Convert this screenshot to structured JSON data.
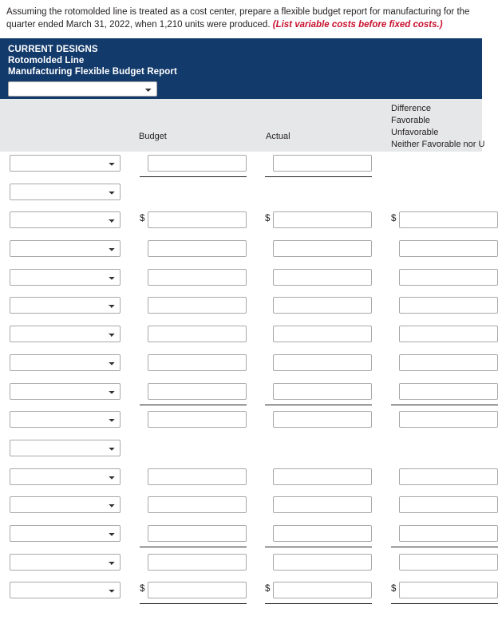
{
  "prompt": {
    "text_part1": "Assuming the rotomolded line is treated as a cost center, prepare a flexible budget report for manufacturing for the quarter ended March 31, 2022, when 1,210 units were produced. ",
    "hint": "(List variable costs before fixed costs.)"
  },
  "report_header": {
    "company": "CURRENT DESIGNS",
    "line": "Rotomolded Line",
    "title": "Manufacturing Flexible Budget Report",
    "period_select_value": ""
  },
  "columns": {
    "budget": "Budget",
    "actual": "Actual",
    "difference_line1": "Difference",
    "difference_line2": "Favorable",
    "difference_line3": "Unfavorable",
    "difference_line4": "Neither Favorable nor U"
  },
  "currency_symbol": "$",
  "rows": [
    {
      "name": "row-units",
      "select_value": "",
      "budget": "",
      "actual": "",
      "difference": "",
      "show_budget": true,
      "show_actual": true,
      "show_difference": false,
      "dollar": false,
      "rule_under": [
        "c1",
        "c2"
      ]
    },
    {
      "name": "row-section-variable",
      "select_value": "",
      "budget": "",
      "actual": "",
      "difference": "",
      "show_budget": false,
      "show_actual": false,
      "show_difference": false,
      "dollar": false,
      "rule_under": []
    },
    {
      "name": "row-variable-1",
      "select_value": "",
      "budget": "",
      "actual": "",
      "difference": "",
      "show_budget": true,
      "show_actual": true,
      "show_difference": true,
      "dollar": true,
      "rule_under": []
    },
    {
      "name": "row-variable-2",
      "select_value": "",
      "budget": "",
      "actual": "",
      "difference": "",
      "show_budget": true,
      "show_actual": true,
      "show_difference": true,
      "dollar": false,
      "rule_under": []
    },
    {
      "name": "row-variable-3",
      "select_value": "",
      "budget": "",
      "actual": "",
      "difference": "",
      "show_budget": true,
      "show_actual": true,
      "show_difference": true,
      "dollar": false,
      "rule_under": []
    },
    {
      "name": "row-variable-4",
      "select_value": "",
      "budget": "",
      "actual": "",
      "difference": "",
      "show_budget": true,
      "show_actual": true,
      "show_difference": true,
      "dollar": false,
      "rule_under": []
    },
    {
      "name": "row-variable-5",
      "select_value": "",
      "budget": "",
      "actual": "",
      "difference": "",
      "show_budget": true,
      "show_actual": true,
      "show_difference": true,
      "dollar": false,
      "rule_under": []
    },
    {
      "name": "row-variable-6",
      "select_value": "",
      "budget": "",
      "actual": "",
      "difference": "",
      "show_budget": true,
      "show_actual": true,
      "show_difference": true,
      "dollar": false,
      "rule_under": []
    },
    {
      "name": "row-variable-7",
      "select_value": "",
      "budget": "",
      "actual": "",
      "difference": "",
      "show_budget": true,
      "show_actual": true,
      "show_difference": true,
      "dollar": false,
      "rule_under": [
        "c1",
        "c2",
        "c3"
      ]
    },
    {
      "name": "row-variable-total",
      "select_value": "",
      "budget": "",
      "actual": "",
      "difference": "",
      "show_budget": true,
      "show_actual": true,
      "show_difference": true,
      "dollar": false,
      "rule_under": []
    },
    {
      "name": "row-section-fixed",
      "select_value": "",
      "budget": "",
      "actual": "",
      "difference": "",
      "show_budget": false,
      "show_actual": false,
      "show_difference": false,
      "dollar": false,
      "rule_under": []
    },
    {
      "name": "row-fixed-1",
      "select_value": "",
      "budget": "",
      "actual": "",
      "difference": "",
      "show_budget": true,
      "show_actual": true,
      "show_difference": true,
      "dollar": false,
      "rule_under": []
    },
    {
      "name": "row-fixed-2",
      "select_value": "",
      "budget": "",
      "actual": "",
      "difference": "",
      "show_budget": true,
      "show_actual": true,
      "show_difference": true,
      "dollar": false,
      "rule_under": []
    },
    {
      "name": "row-fixed-3",
      "select_value": "",
      "budget": "",
      "actual": "",
      "difference": "",
      "show_budget": true,
      "show_actual": true,
      "show_difference": true,
      "dollar": false,
      "rule_under": [
        "c1",
        "c2",
        "c3"
      ]
    },
    {
      "name": "row-fixed-total",
      "select_value": "",
      "budget": "",
      "actual": "",
      "difference": "",
      "show_budget": true,
      "show_actual": true,
      "show_difference": true,
      "dollar": false,
      "rule_under": []
    },
    {
      "name": "row-grand-total",
      "select_value": "",
      "budget": "",
      "actual": "",
      "difference": "",
      "show_budget": true,
      "show_actual": true,
      "show_difference": true,
      "dollar": true,
      "rule_under": [
        "c1",
        "c2",
        "c3"
      ]
    }
  ]
}
